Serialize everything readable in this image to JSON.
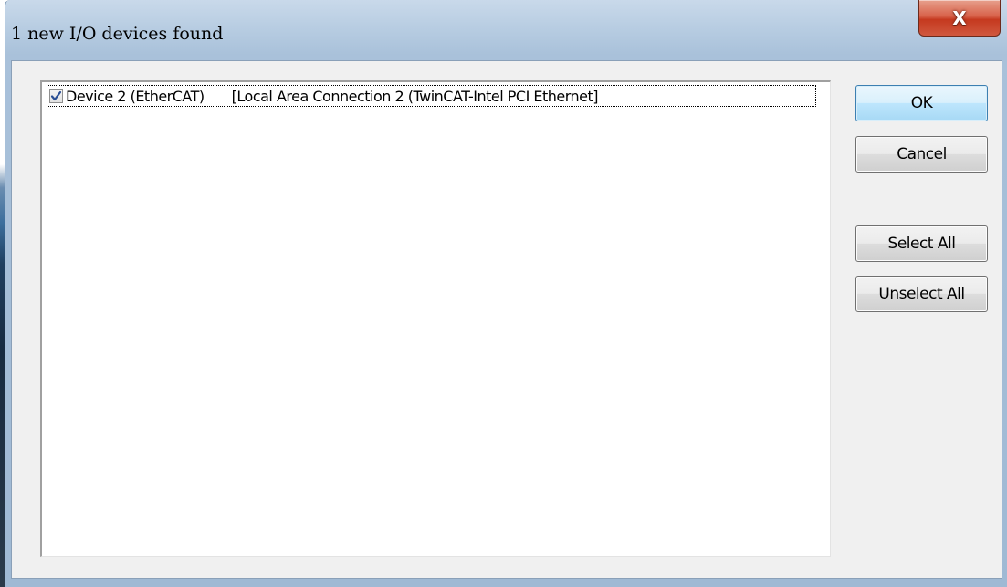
{
  "window": {
    "title": "1 new I/O devices found",
    "close_glyph": "X"
  },
  "device_list": {
    "items": [
      {
        "checked": true,
        "name": "Device 2 (EtherCAT)",
        "connection": "[Local Area Connection 2 (TwinCAT-Intel PCI Ethernet]"
      }
    ]
  },
  "buttons": {
    "ok_label": "OK",
    "cancel_label": "Cancel",
    "select_all_label": "Select All",
    "unselect_all_label": "Unselect All"
  },
  "colors": {
    "close_button": "#c5391f",
    "default_button_border": "#3c7fb1",
    "checkmark": "#2a4f95"
  }
}
